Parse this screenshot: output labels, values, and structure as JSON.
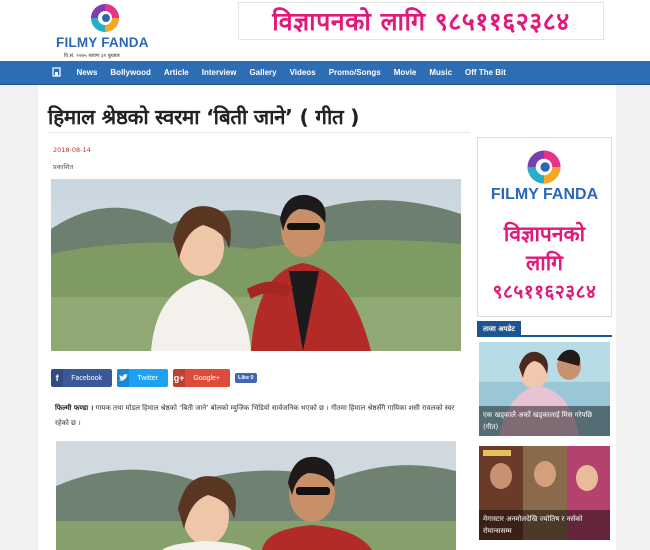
{
  "header": {
    "logo_text": "FILMY FANDA",
    "logo_date": "वि.सं. २०७५ श्रावण ३१ बुधबार",
    "banner_ad": "विज्ञापनको लागि ९८५११६२३८४"
  },
  "nav": {
    "items": [
      "News",
      "Bollywood",
      "Article",
      "Interview",
      "Gallery",
      "Videos",
      "Promo/Songs",
      "Movie",
      "Music",
      "Off The Bit"
    ]
  },
  "article": {
    "title": "हिमाल श्रेष्ठको स्वरमा ‘बिती जाने’ ( गीत )",
    "date": "2018-08-14",
    "status": "प्रकाशित",
    "share": {
      "facebook": "Facebook",
      "twitter": "Twitter",
      "google": "Google+",
      "like": "Like 0"
    },
    "lead": "फिल्मी फण्डा ।",
    "body": " गायक तथा मोडल हिमाल श्रेष्ठको ‘बिती जाने’ बोलको म्युजिक भिडियो सार्वजनिक भएको छ । गीतमा हिमाल श्रेष्ठसँगै गायिका शसी रावलको स्वर रहेको छ ।"
  },
  "sidebar": {
    "ad_logo": "FILMY FANDA",
    "ad_line1": "विज्ञापनको",
    "ad_line2": "लागि",
    "ad_line3": "९८५११६२३८४",
    "latest_heading": "ताजा अपडेट",
    "news": [
      {
        "caption": "एक खड्कालेे अर्को खड्कालाई मिस गरेपछि (गीत)"
      },
      {
        "caption": "मेगास्टार अनमोलदेखि ज्योतिष र नर्सको रोमान्ससम्म"
      }
    ]
  },
  "colors": {
    "brand_blue": "#2c6db3",
    "accent_pink": "#e2187a",
    "date_red": "#c0392b"
  },
  "icons": {
    "home": "home-icon",
    "facebook": "facebook-icon",
    "twitter": "twitter-icon",
    "google": "google-plus-icon"
  }
}
